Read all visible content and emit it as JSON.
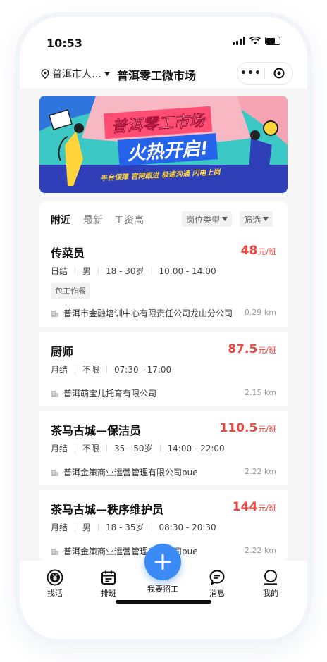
{
  "status": {
    "time": "10:53"
  },
  "nav": {
    "location": "普洱市人…",
    "title": "普洱零工微市场",
    "menu_dots": "•••"
  },
  "banner": {
    "line1": "普洱零工市场",
    "line2": "火热开启!",
    "slogan": "平台保障 官网跟进 极速沟通 闪电上岗"
  },
  "tabs": [
    {
      "label": "附近",
      "active": true
    },
    {
      "label": "最新",
      "active": false
    },
    {
      "label": "工资高",
      "active": false
    }
  ],
  "filters": {
    "position_type": "岗位类型",
    "filter": "筛选"
  },
  "jobs": [
    {
      "name": "传菜员",
      "price": "48",
      "unit": "元/班",
      "meta": [
        "日结",
        "男",
        "18 - 30岁",
        "10:00 - 14:00"
      ],
      "tag": "包工作餐",
      "company": "普洱市金融培训中心有限责任公司龙山分公司",
      "distance": "0.29 km"
    },
    {
      "name": "厨师",
      "price": "87.5",
      "unit": "元/班",
      "meta": [
        "月结",
        "不限",
        "07:30 - 17:00"
      ],
      "company": "普洱萌宝儿托育有限公司",
      "distance": "2.15 km"
    },
    {
      "name": "茶马古城—保洁员",
      "price": "110.5",
      "unit": "元/班",
      "meta": [
        "月结",
        "不限",
        "35 - 50岁",
        "14:00 - 22:00"
      ],
      "company": "普洱金策商业运营管理有限公司pue",
      "distance": "2.22 km"
    },
    {
      "name": "茶马古城—秩序维护员",
      "price": "144",
      "unit": "元/班",
      "meta": [
        "月结",
        "男",
        "18 - 35岁",
        "08:30 - 20:30"
      ],
      "company": "普洱金策商业运营管理有限公司pue",
      "distance": "2.22 km"
    }
  ],
  "tabbar": {
    "find": "找活",
    "schedule": "排班",
    "post": "我要招工",
    "messages": "消息",
    "mine": "我的"
  },
  "colors": {
    "accent": "#3b8bf6",
    "price": "#f0453c"
  }
}
